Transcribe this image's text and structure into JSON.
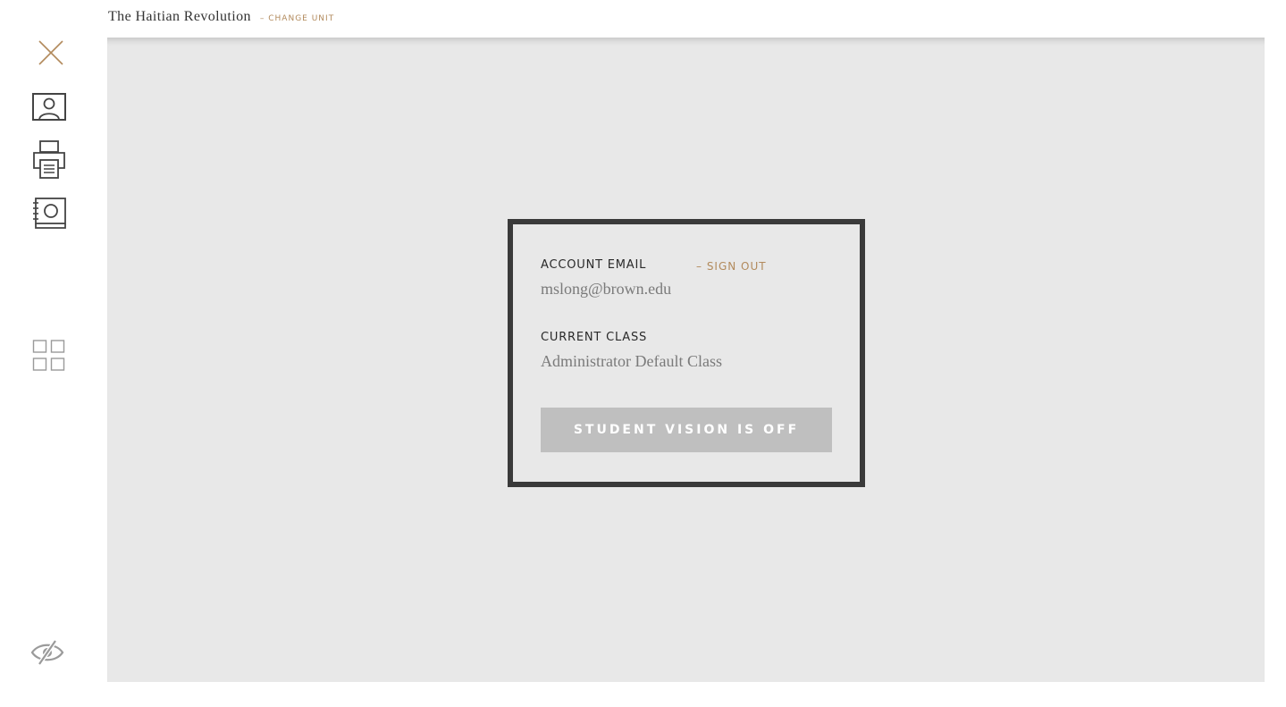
{
  "header": {
    "unit_title": "The Haitian Revolution",
    "change_unit_label": "– CHANGE UNIT"
  },
  "sidebar": {
    "icons": [
      "close-icon",
      "account-icon",
      "print-icon",
      "notebook-icon",
      "grid-view-icon",
      "vision-off-icon"
    ]
  },
  "account_panel": {
    "email_label": "ACCOUNT EMAIL",
    "sign_out_label": "– SIGN OUT",
    "email_value": "mslong@brown.edu",
    "class_label": "CURRENT CLASS",
    "class_value": "Administrator Default Class",
    "vision_button_label": "STUDENT VISION IS OFF"
  },
  "colors": {
    "accent": "#b28a5c",
    "panel_border": "#3a3a3a",
    "main_background": "#e8e8e8",
    "button_background": "#bfbfbf",
    "icon_stroke": "#444444"
  }
}
